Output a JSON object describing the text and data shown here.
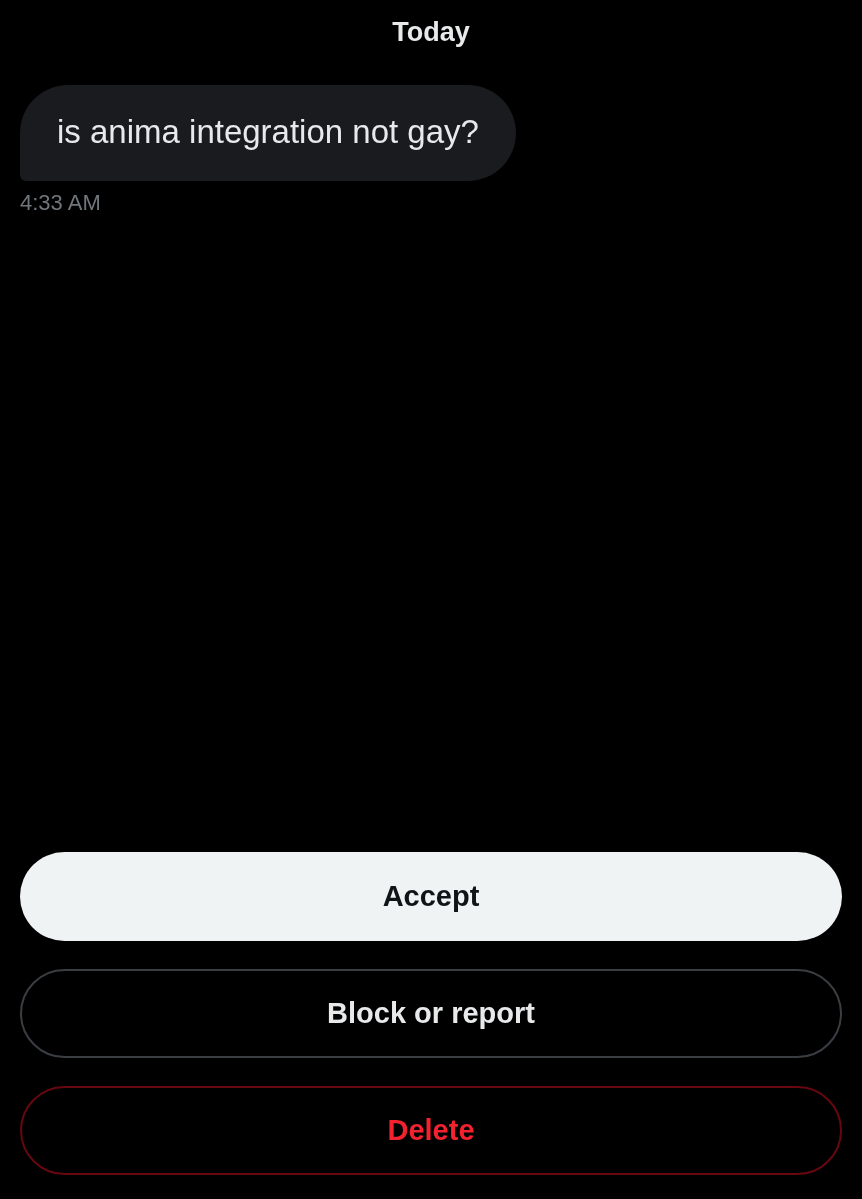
{
  "date_header": "Today",
  "messages": [
    {
      "text": "is anima integration not gay?",
      "time": "4:33 AM"
    }
  ],
  "buttons": [
    {
      "label": "Accept",
      "kind": "primary"
    },
    {
      "label": "Block or report",
      "kind": "secondary"
    },
    {
      "label": "Delete",
      "kind": "destructive"
    }
  ]
}
